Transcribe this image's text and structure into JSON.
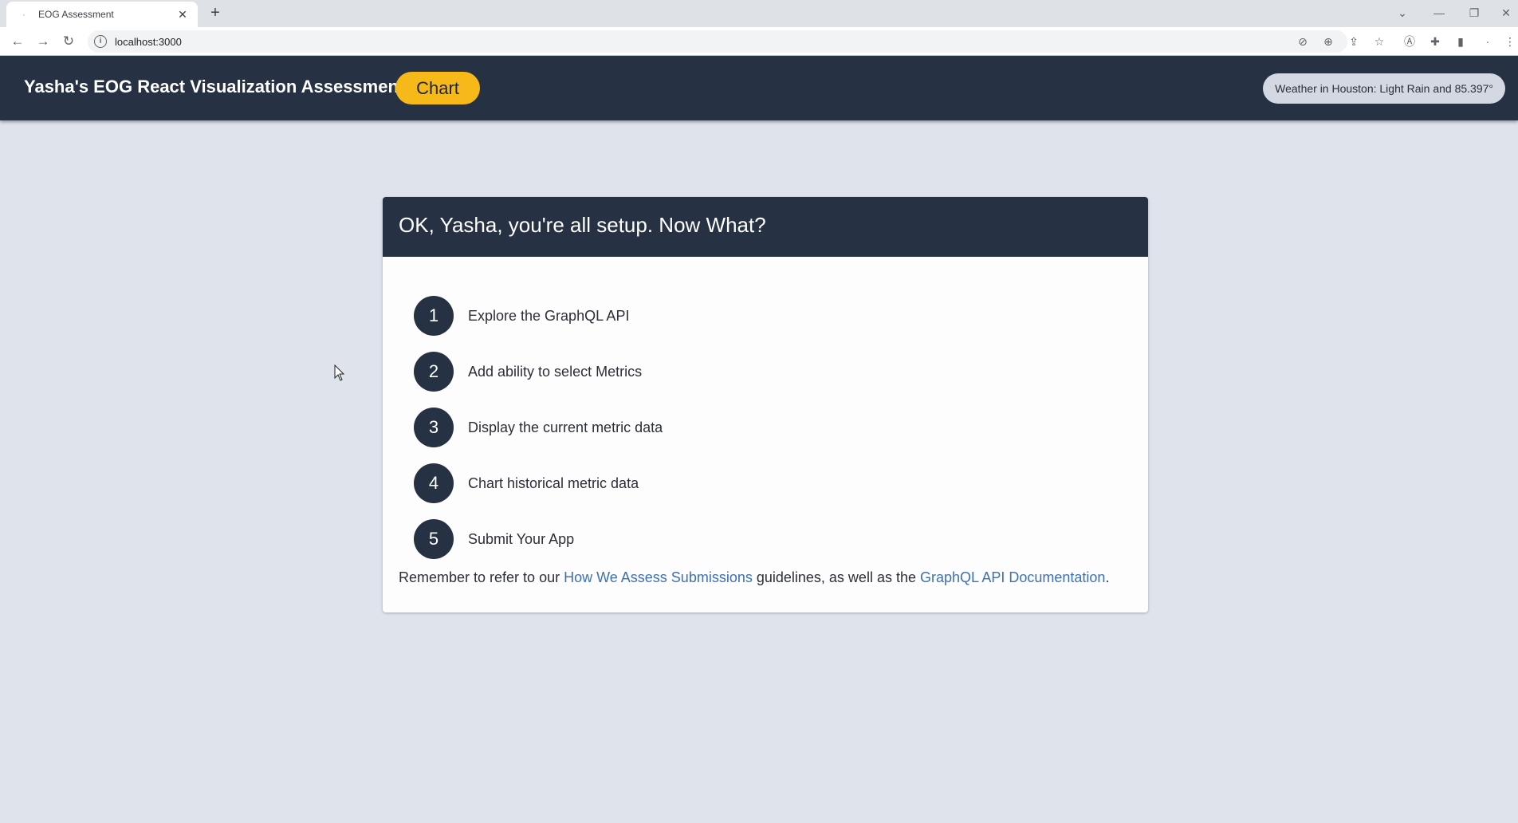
{
  "browser": {
    "tab_title": "EOG Assessment",
    "tab_close": "✕",
    "new_tab": "+",
    "url": "localhost:3000"
  },
  "app": {
    "title": "Yasha's EOG React Visualization Assessment",
    "chart_button": "Chart",
    "weather": "Weather in Houston: Light Rain and 85.397°"
  },
  "card": {
    "heading": "OK, Yasha, you're all setup. Now What?",
    "steps": [
      {
        "number": "1",
        "text": "Explore the GraphQL API"
      },
      {
        "number": "2",
        "text": "Add ability to select Metrics"
      },
      {
        "number": "3",
        "text": "Display the current metric data"
      },
      {
        "number": "4",
        "text": "Chart historical metric data"
      },
      {
        "number": "5",
        "text": "Submit Your App"
      }
    ],
    "footer": {
      "prefix": "Remember to refer to our ",
      "link1": "How We Assess Submissions",
      "middle": " guidelines, as well as the ",
      "link2": "GraphQL API Documentation",
      "suffix": "."
    }
  },
  "colors": {
    "header_bg": "#263143",
    "accent": "#f7b819",
    "page_bg": "#dfe3ec",
    "link": "#3f6fb5"
  },
  "icons": [
    "back-arrow-icon",
    "forward-arrow-icon",
    "reload-icon",
    "info-icon",
    "zoom-icon",
    "share-icon",
    "star-icon",
    "extension-icon",
    "sidebar-icon",
    "menu-icon"
  ]
}
